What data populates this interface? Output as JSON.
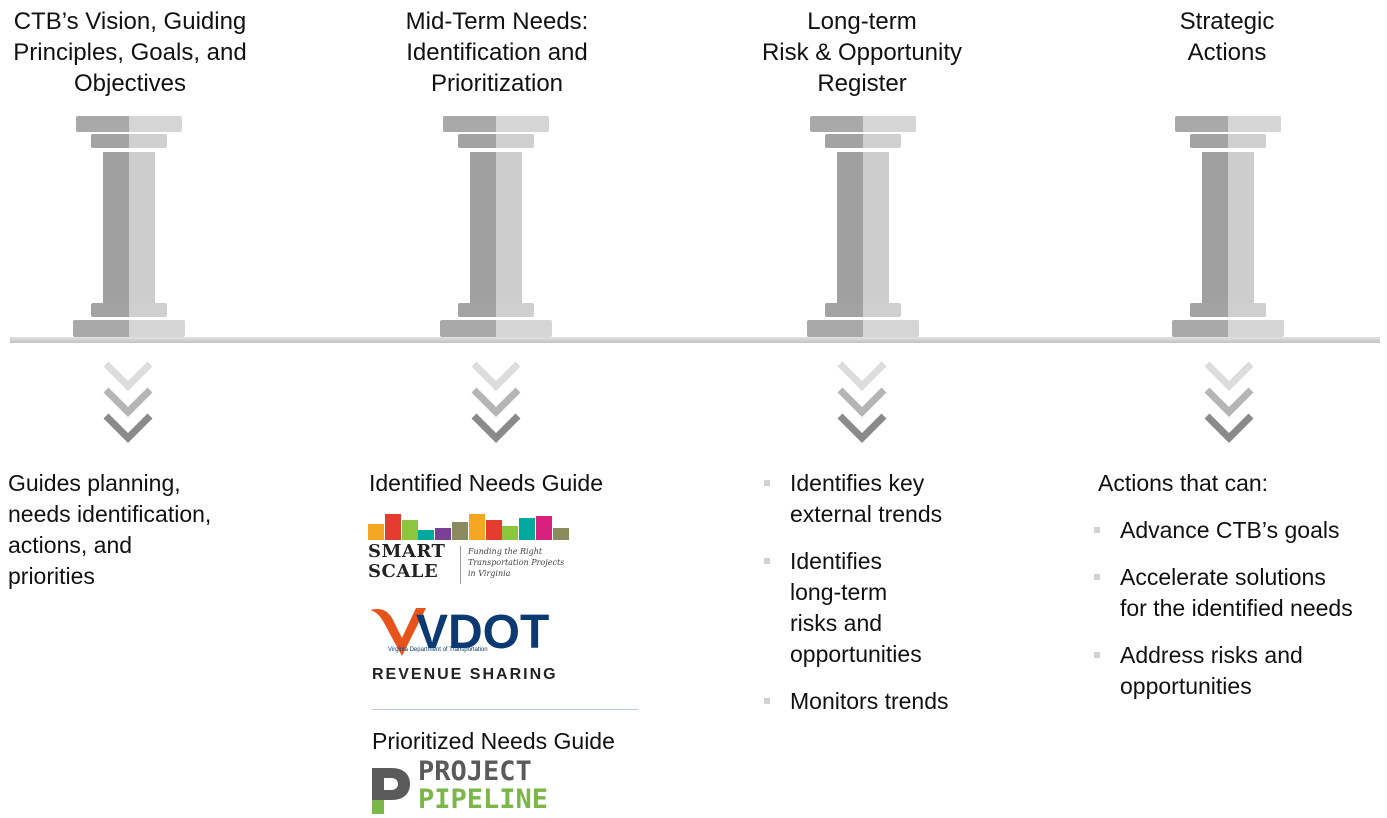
{
  "columns": [
    {
      "title_lines": [
        "CTB’s Vision, Guiding",
        "Principles, Goals, and",
        "Objectives"
      ],
      "description_lines": [
        "Guides planning,",
        "needs identification,",
        "actions, and",
        "priorities"
      ]
    },
    {
      "title_lines": [
        "Mid-Term Needs:",
        "Identification and",
        "Prioritization"
      ],
      "identified_label": "Identified Needs Guide",
      "prioritized_label": "Prioritized Needs Guide"
    },
    {
      "title_lines": [
        "Long-term",
        "Risk & Opportunity",
        "Register"
      ],
      "bullets": [
        {
          "lines": [
            "Identifies key",
            "external trends"
          ]
        },
        {
          "lines": [
            "Identifies",
            "long-term",
            "risks and",
            "opportunities"
          ]
        },
        {
          "lines": [
            "Monitors trends"
          ]
        }
      ]
    },
    {
      "title_lines": [
        "Strategic",
        "Actions"
      ],
      "intro": "Actions that can:",
      "bullets": [
        {
          "lines": [
            "Advance CTB’s goals"
          ]
        },
        {
          "lines": [
            "Accelerate solutions",
            "for the identified needs"
          ]
        },
        {
          "lines": [
            "Address risks and",
            "opportunities"
          ]
        }
      ]
    }
  ],
  "logos": {
    "smart_scale": {
      "word_lines": [
        "SMART",
        "SCALE"
      ],
      "tagline_lines": [
        "Funding the Right",
        "Transportation Projects",
        "in Virginia"
      ],
      "bar_colors": [
        "#f5a623",
        "#e43c2e",
        "#8cc63f",
        "#00a99d",
        "#7b3f98",
        "#8b8b5f",
        "#f5a623",
        "#e43c2e",
        "#8cc63f",
        "#00a99d",
        "#d6217f",
        "#8b8b5f"
      ]
    },
    "vdot": {
      "wordmark": "VDOT",
      "subtitle": "Virginia Department of Transportation",
      "program": "REVENUE SHARING",
      "colors": {
        "brand_blue": "#0b3a73",
        "brand_orange": "#e8531c"
      }
    },
    "project_pipeline": {
      "word_lines": [
        "PROJECT",
        "PIPELINE"
      ],
      "colors": {
        "grey": "#5a5a5a",
        "green": "#7ab648"
      }
    }
  },
  "colors": {
    "pillar_dark": "#a3a3a3",
    "pillar_light": "#d0d0d0",
    "chevron_light": "#dcdcdc",
    "chevron_mid": "#b5b5b5",
    "chevron_dark": "#8a8a8a",
    "bullet_marker": "#d2d2d2",
    "separator": "#b9c7e2"
  },
  "icons": [
    "pillar-icon",
    "chevron-down-icon",
    "bullet-square-icon"
  ]
}
